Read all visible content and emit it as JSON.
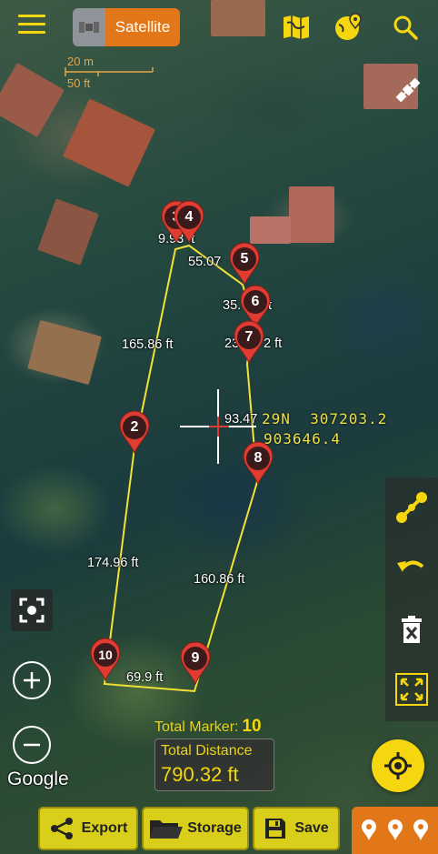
{
  "map_type": "Satellite",
  "scale": {
    "metric": "20 m",
    "imperial": "50 ft"
  },
  "markers": [
    "2",
    "3",
    "4",
    "5",
    "6",
    "7",
    "8",
    "9",
    "10"
  ],
  "segments": [
    "165.86 ft",
    "9.93 ft",
    "55.07",
    "35.",
    "ft",
    "23.",
    "2 ft",
    "93.47",
    "160.86 ft",
    "69.9 ft",
    "174.96 ft"
  ],
  "coordinates": {
    "line1": "29N  307203.2",
    "line2": "903646.4"
  },
  "totals": {
    "marker_label": "Total Marker:",
    "marker_count": "10",
    "distance_label": "Total Distance",
    "distance_value": "790.32 ft"
  },
  "attribution": "Google",
  "bottom_bar": {
    "export": "Export",
    "storage": "Storage",
    "save": "Save"
  },
  "colors": {
    "accent": "#f5d60f",
    "orange": "#e2771a",
    "line": "#f2e233",
    "marker": "#e03c31"
  }
}
